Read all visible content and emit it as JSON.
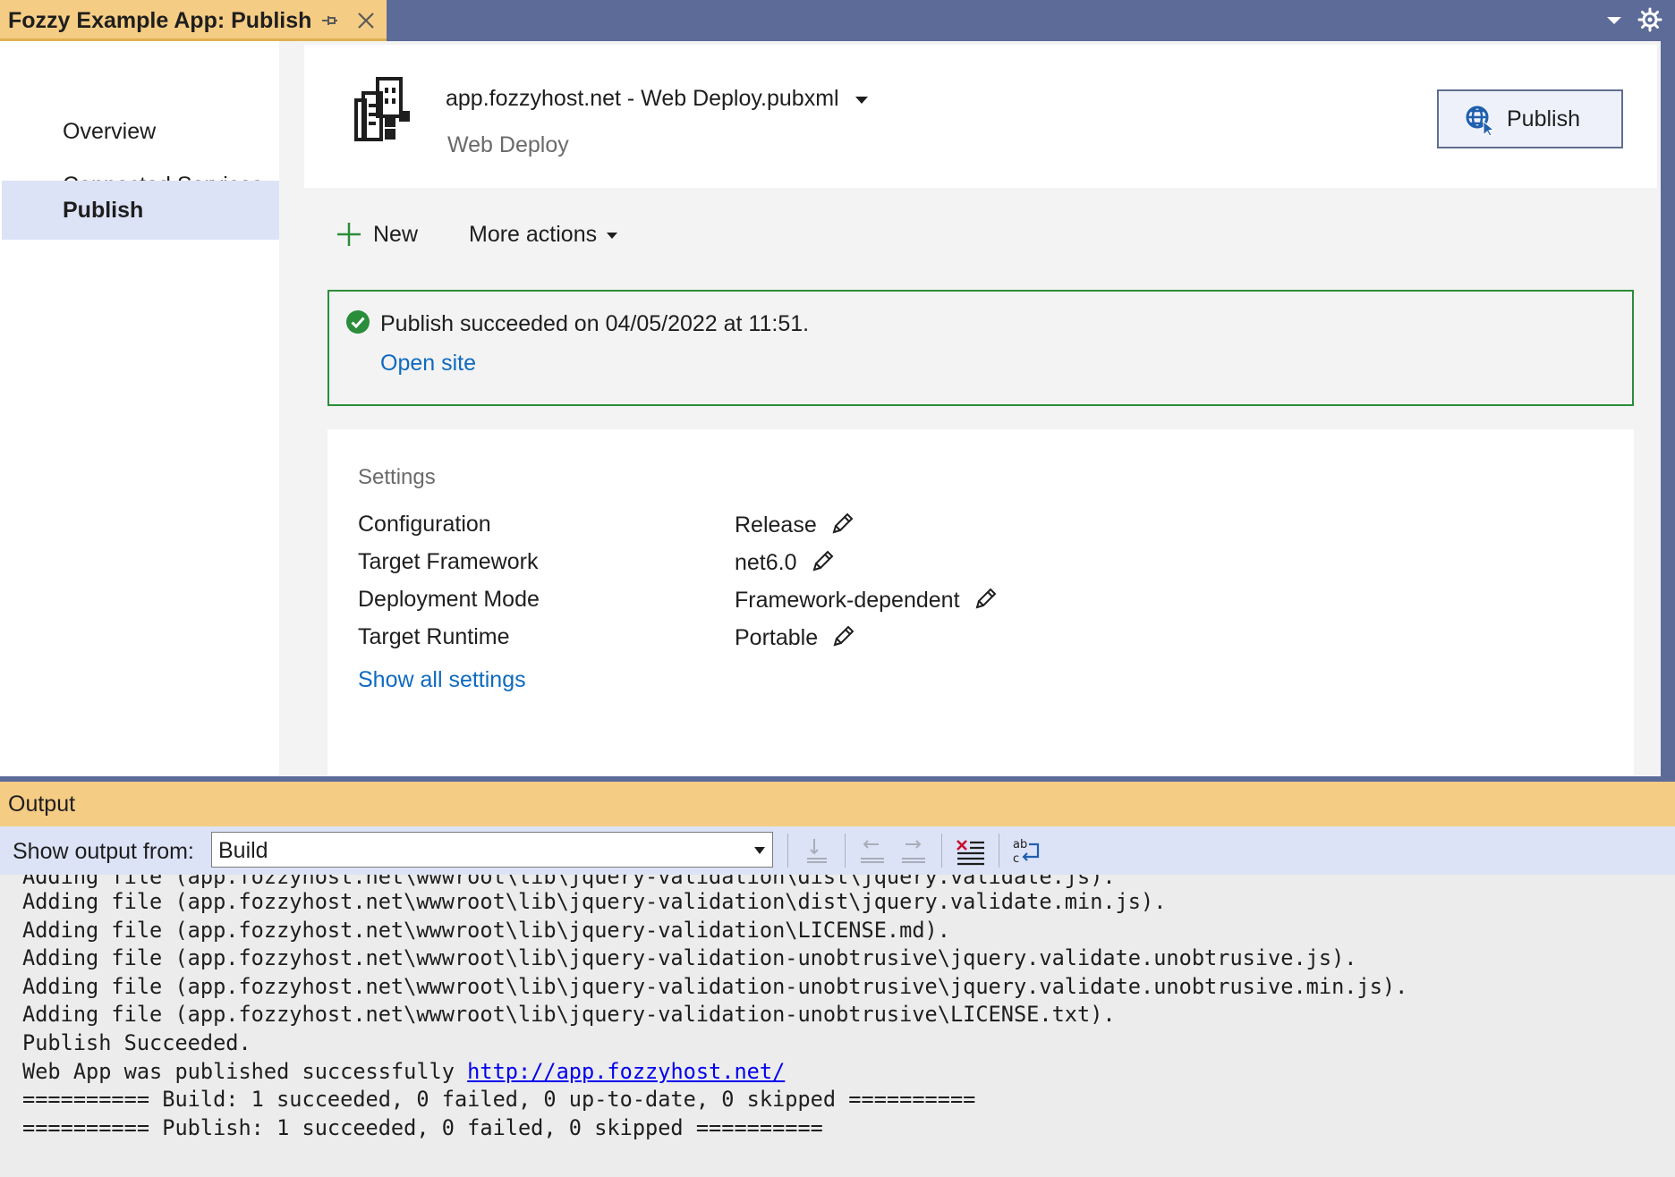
{
  "window": {
    "tab_title": "Fozzy Example App: Publish"
  },
  "sidebar": {
    "items": [
      {
        "label": "Overview",
        "active": false
      },
      {
        "label": "Connected Services",
        "active": false
      },
      {
        "label": "Publish",
        "active": true
      }
    ]
  },
  "profile": {
    "name": "app.fozzyhost.net - Web Deploy.pubxml",
    "type": "Web Deploy",
    "publish_label": "Publish"
  },
  "actions": {
    "new_label": "New",
    "more_actions_label": "More actions"
  },
  "status": {
    "message": "Publish succeeded on 04/05/2022 at 11:51.",
    "open_site_label": "Open site",
    "color": "#2a8d3a"
  },
  "settings": {
    "title": "Settings",
    "rows": [
      {
        "label": "Configuration",
        "value": "Release"
      },
      {
        "label": "Target Framework",
        "value": "net6.0"
      },
      {
        "label": "Deployment Mode",
        "value": "Framework-dependent"
      },
      {
        "label": "Target Runtime",
        "value": "Portable"
      }
    ],
    "show_all_label": "Show all settings"
  },
  "output": {
    "title": "Output",
    "show_from_label": "Show output from:",
    "source_value": "Build",
    "lines": [
      "Adding file (app.fozzyhost.net\\wwwroot\\lib\\jquery-validation\\dist\\jquery.validate.js).",
      "Adding file (app.fozzyhost.net\\wwwroot\\lib\\jquery-validation\\dist\\jquery.validate.min.js).",
      "Adding file (app.fozzyhost.net\\wwwroot\\lib\\jquery-validation\\LICENSE.md).",
      "Adding file (app.fozzyhost.net\\wwwroot\\lib\\jquery-validation-unobtrusive\\jquery.validate.unobtrusive.js).",
      "Adding file (app.fozzyhost.net\\wwwroot\\lib\\jquery-validation-unobtrusive\\jquery.validate.unobtrusive.min.js).",
      "Adding file (app.fozzyhost.net\\wwwroot\\lib\\jquery-validation-unobtrusive\\LICENSE.txt).",
      "Publish Succeeded."
    ],
    "published_prefix": "Web App was published successfully ",
    "published_url": "http://app.fozzyhost.net/",
    "summary_lines": [
      "========== Build: 1 succeeded, 0 failed, 0 up-to-date, 0 skipped ==========",
      "========== Publish: 1 succeeded, 0 failed, 0 skipped =========="
    ]
  },
  "colors": {
    "accent_tab": "#f5cc84",
    "title_bar": "#5d6b99",
    "link": "#0e6ac0",
    "selected": "#dce3f7"
  }
}
